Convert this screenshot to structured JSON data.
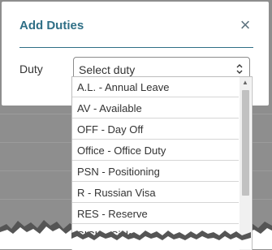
{
  "modal": {
    "title": "Add Duties",
    "close_glyph": "×",
    "divider_color": "#2f6f86",
    "title_color": "#2f6f86"
  },
  "form": {
    "duty_label": "Duty",
    "duty_select": {
      "value": "Select duty",
      "arrow_icon": "up-down-chevron-icon"
    }
  },
  "dropdown": {
    "options": [
      "A.L. - Annual Leave",
      "AV - Available",
      "OFF - Day Off",
      "Office - Office Duty",
      "PSN - Positioning",
      "R - Russian Visa",
      "RES - Reserve",
      "SICK - Sick"
    ],
    "scroll_up_glyph": "▲"
  }
}
